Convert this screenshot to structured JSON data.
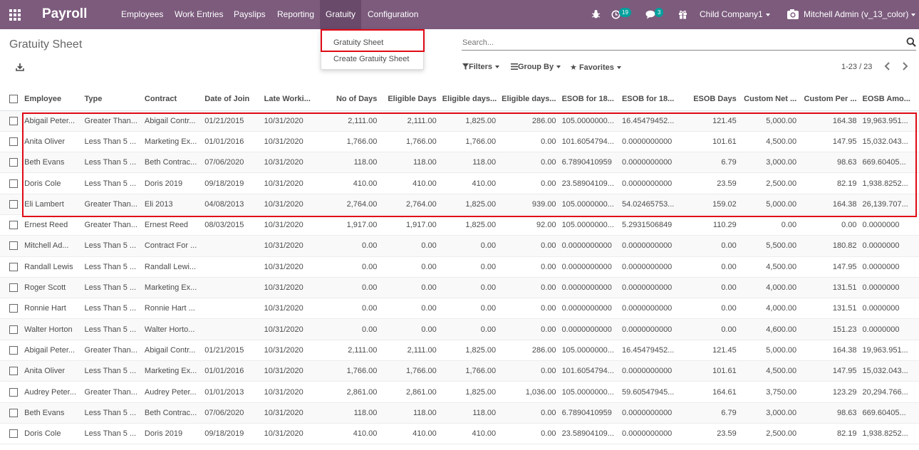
{
  "navbar": {
    "app_name": "Payroll",
    "menu": [
      "Employees",
      "Work Entries",
      "Payslips",
      "Reporting",
      "Gratuity",
      "Configuration"
    ],
    "active": "Gratuity",
    "activity_count": "19",
    "messages_count": "3",
    "company": "Child Company1",
    "user": "Mitchell Admin (v_13_color)",
    "accent_color": "#7c5b7d"
  },
  "dropdown": {
    "items": [
      "Gratuity Sheet",
      "Create Gratuity Sheet"
    ]
  },
  "control_panel": {
    "title": "Gratuity Sheet",
    "search_placeholder": "Search...",
    "filters_label": "Filters",
    "group_by_label": "Group By",
    "favorites_label": "Favorites",
    "pager": "1-23 / 23"
  },
  "table": {
    "columns": [
      "Employee",
      "Type",
      "Contract",
      "Date of Join",
      "Late Worki...",
      "No of Days",
      "Eligible Days",
      "Eligible days...",
      "Eligible days...",
      "ESOB for 18...",
      "ESOB for 18...",
      "ESOB Days",
      "Custom Net ...",
      "Custom Per ...",
      "EOSB Amo..."
    ],
    "rows": [
      [
        "Abigail Peter...",
        "Greater Than...",
        "Abigail Contr...",
        "01/21/2015",
        "10/31/2020",
        "2,111.00",
        "2,111.00",
        "1,825.00",
        "286.00",
        "105.0000000...",
        "16.45479452...",
        "121.45",
        "5,000.00",
        "164.38",
        "19,963.951..."
      ],
      [
        "Anita Oliver",
        "Less Than 5 ...",
        "Marketing Ex...",
        "01/01/2016",
        "10/31/2020",
        "1,766.00",
        "1,766.00",
        "1,766.00",
        "0.00",
        "101.6054794...",
        "0.0000000000",
        "101.61",
        "4,500.00",
        "147.95",
        "15,032.043..."
      ],
      [
        "Beth Evans",
        "Less Than 5 ...",
        "Beth Contrac...",
        "07/06/2020",
        "10/31/2020",
        "118.00",
        "118.00",
        "118.00",
        "0.00",
        "6.7890410959",
        "0.0000000000",
        "6.79",
        "3,000.00",
        "98.63",
        "669.60405..."
      ],
      [
        "Doris Cole",
        "Less Than 5 ...",
        "Doris 2019",
        "09/18/2019",
        "10/31/2020",
        "410.00",
        "410.00",
        "410.00",
        "0.00",
        "23.58904109...",
        "0.0000000000",
        "23.59",
        "2,500.00",
        "82.19",
        "1,938.8252..."
      ],
      [
        "Eli Lambert",
        "Greater Than...",
        "Eli 2013",
        "04/08/2013",
        "10/31/2020",
        "2,764.00",
        "2,764.00",
        "1,825.00",
        "939.00",
        "105.0000000...",
        "54.02465753...",
        "159.02",
        "5,000.00",
        "164.38",
        "26,139.707..."
      ],
      [
        "Ernest Reed",
        "Greater Than...",
        "Ernest Reed",
        "08/03/2015",
        "10/31/2020",
        "1,917.00",
        "1,917.00",
        "1,825.00",
        "92.00",
        "105.0000000...",
        "5.2931506849",
        "110.29",
        "0.00",
        "0.00",
        "0.0000000"
      ],
      [
        "Mitchell Ad...",
        "Less Than 5 ...",
        "Contract For ...",
        "",
        "10/31/2020",
        "0.00",
        "0.00",
        "0.00",
        "0.00",
        "0.0000000000",
        "0.0000000000",
        "0.00",
        "5,500.00",
        "180.82",
        "0.0000000"
      ],
      [
        "Randall Lewis",
        "Less Than 5 ...",
        "Randall Lewi...",
        "",
        "10/31/2020",
        "0.00",
        "0.00",
        "0.00",
        "0.00",
        "0.0000000000",
        "0.0000000000",
        "0.00",
        "4,500.00",
        "147.95",
        "0.0000000"
      ],
      [
        "Roger Scott",
        "Less Than 5 ...",
        "Marketing Ex...",
        "",
        "10/31/2020",
        "0.00",
        "0.00",
        "0.00",
        "0.00",
        "0.0000000000",
        "0.0000000000",
        "0.00",
        "4,000.00",
        "131.51",
        "0.0000000"
      ],
      [
        "Ronnie Hart",
        "Less Than 5 ...",
        "Ronnie Hart ...",
        "",
        "10/31/2020",
        "0.00",
        "0.00",
        "0.00",
        "0.00",
        "0.0000000000",
        "0.0000000000",
        "0.00",
        "4,000.00",
        "131.51",
        "0.0000000"
      ],
      [
        "Walter Horton",
        "Less Than 5 ...",
        "Walter Horto...",
        "",
        "10/31/2020",
        "0.00",
        "0.00",
        "0.00",
        "0.00",
        "0.0000000000",
        "0.0000000000",
        "0.00",
        "4,600.00",
        "151.23",
        "0.0000000"
      ],
      [
        "Abigail Peter...",
        "Greater Than...",
        "Abigail Contr...",
        "01/21/2015",
        "10/31/2020",
        "2,111.00",
        "2,111.00",
        "1,825.00",
        "286.00",
        "105.0000000...",
        "16.45479452...",
        "121.45",
        "5,000.00",
        "164.38",
        "19,963.951..."
      ],
      [
        "Anita Oliver",
        "Less Than 5 ...",
        "Marketing Ex...",
        "01/01/2016",
        "10/31/2020",
        "1,766.00",
        "1,766.00",
        "1,766.00",
        "0.00",
        "101.6054794...",
        "0.0000000000",
        "101.61",
        "4,500.00",
        "147.95",
        "15,032.043..."
      ],
      [
        "Audrey Peter...",
        "Greater Than...",
        "Audrey Peter...",
        "01/01/2013",
        "10/31/2020",
        "2,861.00",
        "2,861.00",
        "1,825.00",
        "1,036.00",
        "105.0000000...",
        "59.60547945...",
        "164.61",
        "3,750.00",
        "123.29",
        "20,294.766..."
      ],
      [
        "Beth Evans",
        "Less Than 5 ...",
        "Beth Contrac...",
        "07/06/2020",
        "10/31/2020",
        "118.00",
        "118.00",
        "118.00",
        "0.00",
        "6.7890410959",
        "0.0000000000",
        "6.79",
        "3,000.00",
        "98.63",
        "669.60405..."
      ],
      [
        "Doris Cole",
        "Less Than 5 ...",
        "Doris 2019",
        "09/18/2019",
        "10/31/2020",
        "410.00",
        "410.00",
        "410.00",
        "0.00",
        "23.58904109...",
        "0.0000000000",
        "23.59",
        "2,500.00",
        "82.19",
        "1,938.8252..."
      ]
    ]
  }
}
